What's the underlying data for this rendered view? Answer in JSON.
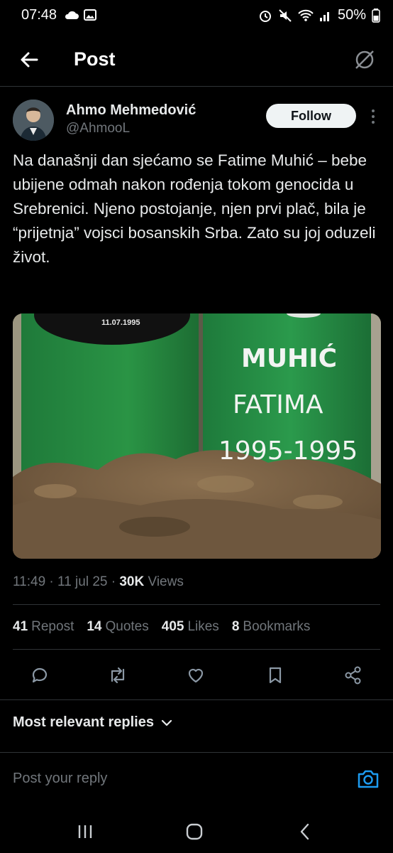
{
  "status_bar": {
    "time": "07:48",
    "battery": "50%"
  },
  "header": {
    "title": "Post"
  },
  "author": {
    "name": "Ahmo Mehmedović",
    "handle": "@AhmooL"
  },
  "follow_label": "Follow",
  "tweet": {
    "text": "Na današnji dan sjećamo se Fatime Muhić – bebe ubijene odmah nakon rođenja tokom genocida u Srebrenici. Njeno postojanje, njen prvi plač, bila je “prijetnja” vojsci bosanskih Srba. Zato su joj oduzeli život."
  },
  "media": {
    "left_date": "11.07.1995",
    "line1": "MUHIĆ",
    "line2": "FATIMA",
    "line3": "1995-1995"
  },
  "meta": {
    "time": "11:49",
    "sep1": " · ",
    "date": "11 jul 25",
    "sep2": " · ",
    "views_count": "30K",
    "views_label": " Views"
  },
  "stats": {
    "reposts_count": "41",
    "reposts_label": "Repost",
    "quotes_count": "14",
    "quotes_label": "Quotes",
    "likes_count": "405",
    "likes_label": "Likes",
    "bookmarks_count": "8",
    "bookmarks_label": "Bookmarks"
  },
  "replies_filter": "Most relevant replies",
  "reply_placeholder": "Post your reply",
  "colors": {
    "accent": "#1d9bf0",
    "background": "#000000",
    "divider": "#2f3336",
    "muted": "#71767b"
  },
  "icons": [
    "back-arrow-icon",
    "grok-icon",
    "more-icon",
    "reply-icon",
    "repost-icon",
    "like-icon",
    "bookmark-icon",
    "share-icon",
    "chevron-down-icon",
    "camera-icon"
  ]
}
